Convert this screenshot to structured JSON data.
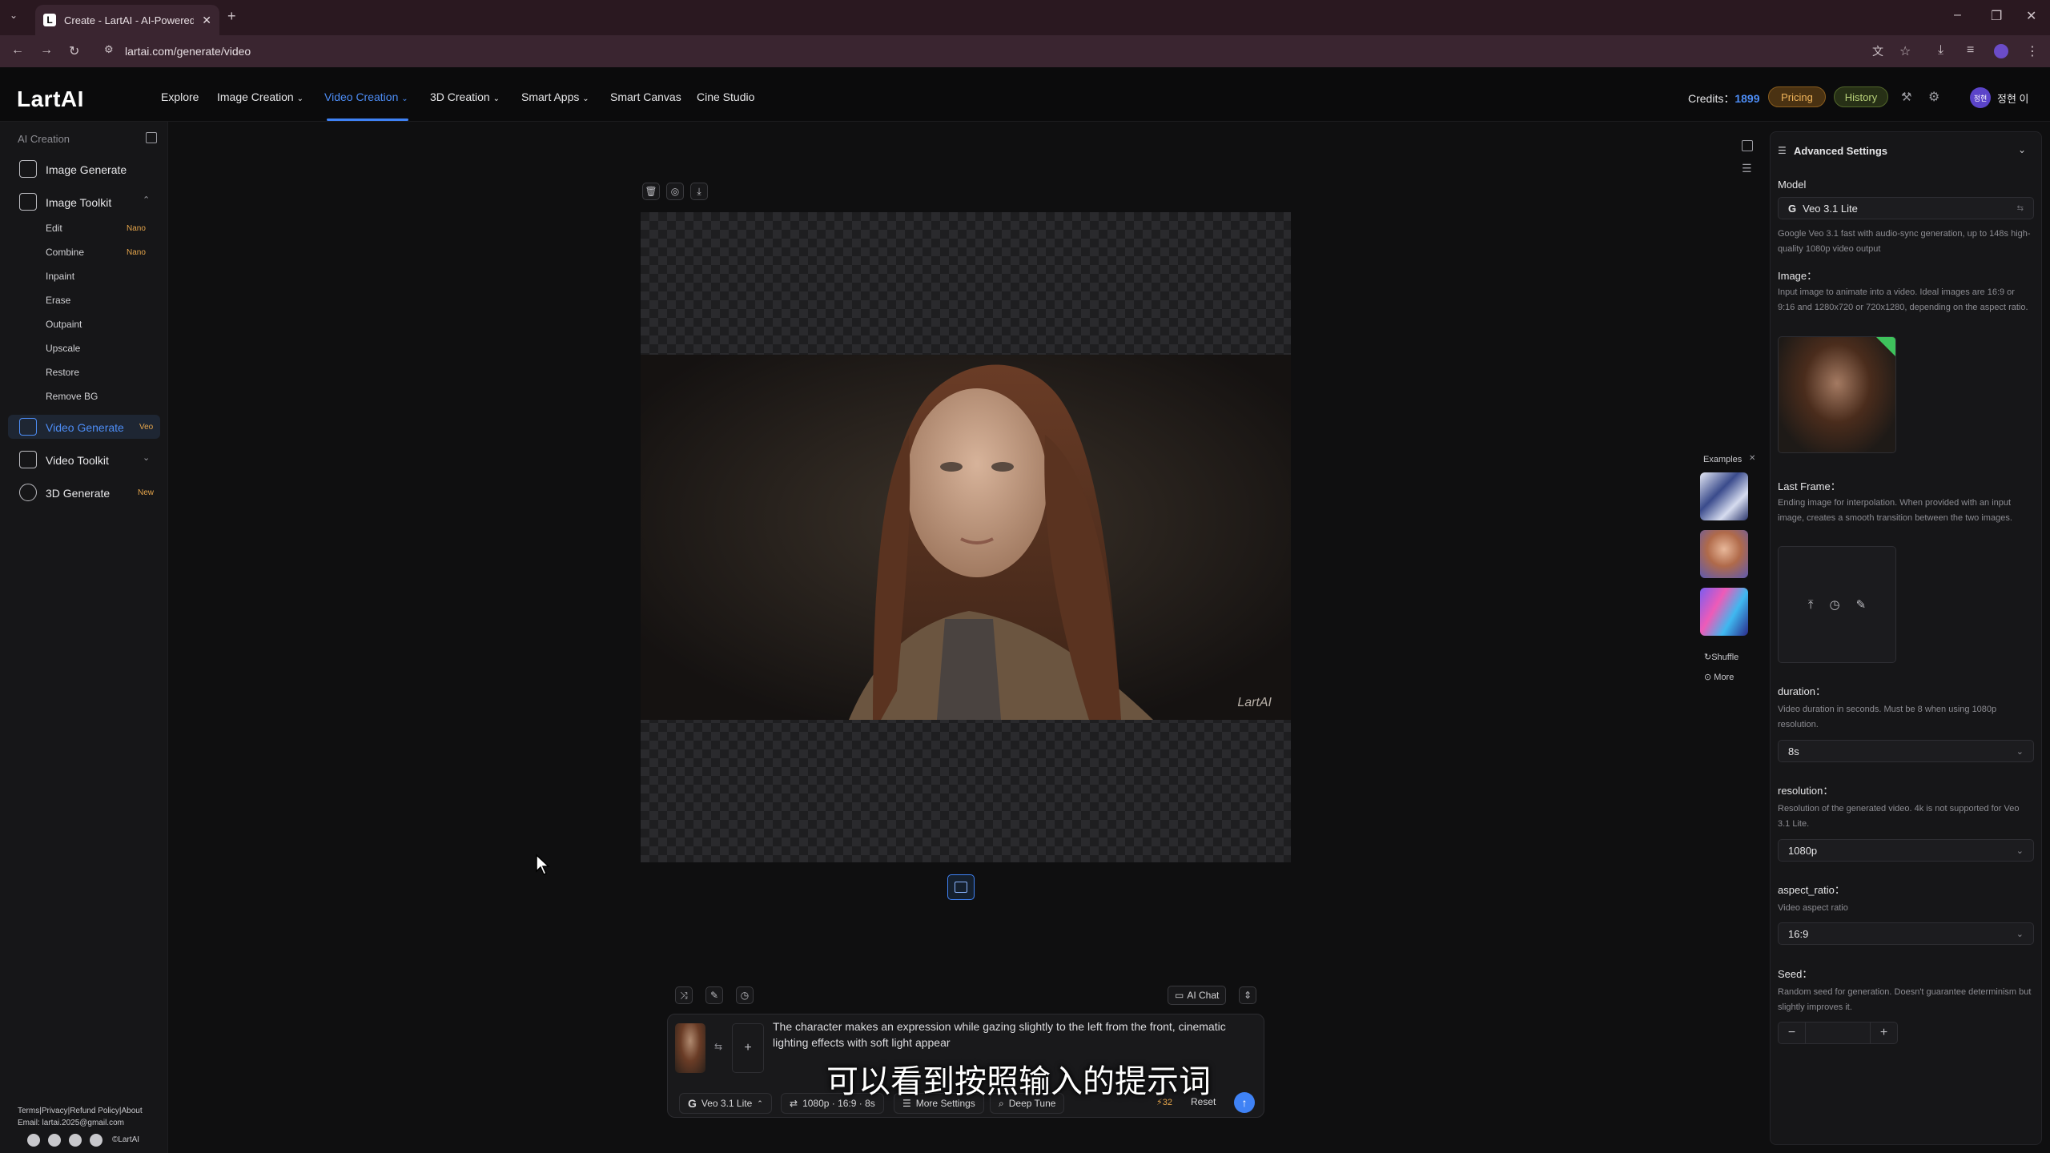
{
  "browser": {
    "tab_title": "Create - LartAI - AI-Powered C",
    "tab_favicon": "L",
    "url": "lartai.com/generate/video",
    "new_tab_symbol": "+"
  },
  "header": {
    "logo": "LartAI",
    "nav": [
      {
        "label": "Explore",
        "dropdown": false
      },
      {
        "label": "Image Creation",
        "dropdown": true
      },
      {
        "label": "Video Creation",
        "dropdown": true,
        "active": true
      },
      {
        "label": "3D Creation",
        "dropdown": true
      },
      {
        "label": "Smart Apps",
        "dropdown": true
      },
      {
        "label": "Smart Canvas",
        "dropdown": false
      },
      {
        "label": "Cine Studio",
        "dropdown": false
      }
    ],
    "credits_label": "Credits：",
    "credits_value": "1899",
    "pricing_label": "Pricing",
    "history_label": "History",
    "avatar_text": "정현",
    "user_name": "정현 이"
  },
  "sidebar": {
    "section_title": "AI Creation",
    "image_generate": "Image Generate",
    "image_toolkit": "Image Toolkit",
    "toolkit_items": [
      {
        "label": "Edit",
        "tag": "Nano"
      },
      {
        "label": "Combine",
        "tag": "Nano"
      },
      {
        "label": "Inpaint",
        "tag": ""
      },
      {
        "label": "Erase",
        "tag": ""
      },
      {
        "label": "Outpaint",
        "tag": ""
      },
      {
        "label": "Upscale",
        "tag": ""
      },
      {
        "label": "Restore",
        "tag": ""
      },
      {
        "label": "Remove BG",
        "tag": ""
      }
    ],
    "video_generate": "Video Generate",
    "video_generate_tag": "Veo",
    "video_toolkit": "Video Toolkit",
    "generate_3d": "3D Generate",
    "generate_3d_tag": "New"
  },
  "canvas": {
    "watermark": "LartAI"
  },
  "examples": {
    "title": "Examples",
    "shuffle": "Shuffle",
    "more": "More"
  },
  "prompt": {
    "text": "The character makes an expression while gazing slightly to the left from the front, cinematic lighting effects with soft light appear",
    "ai_chat": "AI Chat",
    "model_chip": "Veo 3.1 Lite",
    "settings_chip": "1080p · 16:9 · 8s",
    "more_settings": "More Settings",
    "deep_tune": "Deep Tune",
    "cost": "32",
    "reset": "Reset"
  },
  "subtitle_overlay": "可以看到按照输入的提示词",
  "panel": {
    "title": "Advanced Settings",
    "model_label": "Model",
    "model_value": "Veo 3.1 Lite",
    "model_desc": "Google Veo 3.1 fast with audio-sync generation, up to 148s high-quality 1080p video output",
    "image_label": "Image：",
    "image_desc": "Input image to animate into a video. Ideal images are 16:9 or 9:16 and 1280x720 or 720x1280, depending on the aspect ratio.",
    "last_frame_label": "Last Frame：",
    "last_frame_desc": "Ending image for interpolation. When provided with an input image, creates a smooth transition between the two images.",
    "duration_label": "duration：",
    "duration_desc": "Video duration in seconds. Must be 8 when using 1080p resolution.",
    "duration_value": "8s",
    "resolution_label": "resolution：",
    "resolution_desc": "Resolution of the generated video. 4k is not supported for Veo 3.1 Lite.",
    "resolution_value": "1080p",
    "aspect_label": "aspect_ratio：",
    "aspect_desc": "Video aspect ratio",
    "aspect_value": "16:9",
    "seed_label": "Seed：",
    "seed_desc": "Random seed for generation. Doesn't guarantee determinism but slightly improves it.",
    "seed_value": ""
  },
  "footer": {
    "links": "Terms|Privacy|Refund Policy|About",
    "email": "Email: lartai.2025@gmail.com",
    "copyright": "©LartAI"
  },
  "colors": {
    "accent": "#3f82f5",
    "tag_orange": "#e5a54b",
    "pricing_bg": "#5a3a12",
    "history_bg": "#2f3a1c"
  }
}
